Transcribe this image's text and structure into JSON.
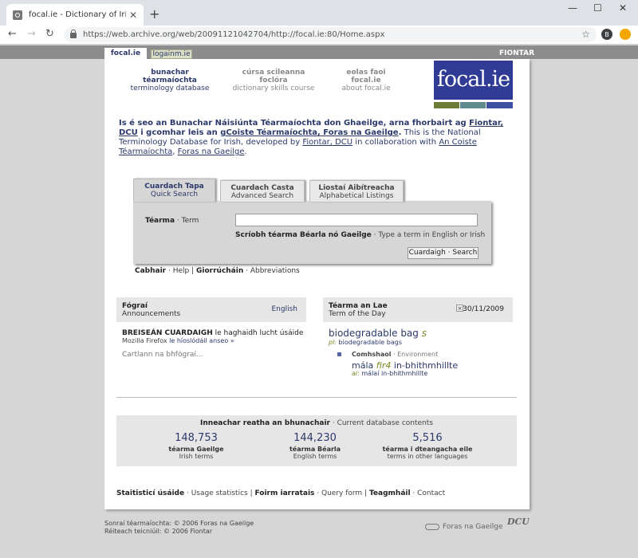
{
  "browser": {
    "tab_title": "focal.ie - Dictionary of Irish Terms",
    "url": "https://web.archive.org/web/20091121042704/http://focal.ie:80/Home.aspx",
    "profile_initial": "B"
  },
  "site_tabs": {
    "active": "focal.ie",
    "other": "logainm.ie",
    "org": "FIONTAR"
  },
  "top_nav": [
    {
      "ga": "bunachar téarmaíochta",
      "en": "terminology database"
    },
    {
      "ga": "cúrsa scileanna foclóra",
      "en": "dictionary skills course"
    },
    {
      "ga": "eolas faoi focal.ie",
      "en": "about focal.ie"
    }
  ],
  "logo_text": "focal.ie",
  "logo_bar_colors": [
    "#6e7d3a",
    "#5f8a90",
    "#3f51a3"
  ],
  "intro": {
    "ga_part1": "Is é seo an Bunachar Náisiúnta Téarmaíochta don Ghaeilge, arna fhorbairt ag ",
    "ga_link1": "Fiontar, DCU",
    "ga_part2": " i gcomhar leis an ",
    "ga_link2": "gCoiste Téarmaíochta, Foras na Gaeilge",
    "ga_part3": ".",
    "en_part1": " This is the National Terminology Database for Irish, developed by ",
    "en_link1": "Fiontar, DCU",
    "en_part2": " in collaboration with ",
    "en_link2": "An Coiste Téarmaíochta",
    "en_part3": ", ",
    "en_link3": "Foras na Gaeilge",
    "en_part4": "."
  },
  "search_tabs": [
    {
      "ga": "Cuardach Tapa",
      "en": "Quick Search"
    },
    {
      "ga": "Cuardach Casta",
      "en": "Advanced Search"
    },
    {
      "ga": "Liostaí Aibítreacha",
      "en": "Alphabetical Listings"
    }
  ],
  "search": {
    "term_label_ga": "Téarma",
    "term_label_en": " · Term",
    "input_value": "",
    "hint_ga": "Scríobh téarma Béarla nó Gaeilge",
    "hint_en": " · Type a term in English or Irish",
    "button": "Cuardaigh · Search"
  },
  "help_row": {
    "help_ga": "Cabhair",
    "help_en": " · Help",
    "sep": " | ",
    "abbr_ga": "Giorrúcháin",
    "abbr_en": " · Abbreviations"
  },
  "announcements": {
    "title": "Fógraí",
    "subtitle": "Announcements",
    "lang_link": "English",
    "line1_bold": "BREISEÁN CUARDAIGH",
    "line1_rest": " le haghaidh lucht úsáide",
    "line2_text": "Mozilla Firefox ",
    "line2_link": "le híoslódáil anseo »",
    "archive": "Cartlann na bhfógraí..."
  },
  "term_of_day": {
    "title": "Téarma an Lae",
    "subtitle": "Term of the Day",
    "close": "×",
    "date": "30/11/2009",
    "term": "biodegradable bag",
    "term_pos": "s",
    "pl_label": "pl:",
    "pl_value": " biodegradable bags",
    "domain_ga": "Comhshaol",
    "domain_en": " · Environment",
    "ga_term": "mála ",
    "ga_pos": "fir4",
    "ga_term2": " in-bhithmhillte",
    "ai_label": "ai:",
    "ai_value": " málaí in-bhithmhillte"
  },
  "stats": {
    "title_ga": "Inneachar reatha an bhunachair",
    "title_en": " · Current database contents",
    "items": [
      {
        "num": "148,753",
        "ga": "téarma Gaeilge",
        "en": "Irish terms"
      },
      {
        "num": "144,230",
        "ga": "téarma Béarla",
        "en": "English terms"
      },
      {
        "num": "5,516",
        "ga": "téarma i dteangacha eile",
        "en": "terms in other languages"
      }
    ]
  },
  "footer_links": {
    "l1_ga": "Staitisticí úsáide",
    "l1_en": " · Usage statistics",
    "l2_ga": "Foirm iarratais",
    "l2_en": " · Query form",
    "l3_ga": "Teagmháil",
    "l3_en": " · Contact",
    "sep": " | "
  },
  "copyright": {
    "line1": "Sonraí téarmaíochta: © 2006 Foras na Gaeilge",
    "line2": "Réiteach teicniúil: © 2006 Fiontar"
  },
  "footer_logos": {
    "foras": "Foras na Gaeilge",
    "dcu": "DCU"
  }
}
